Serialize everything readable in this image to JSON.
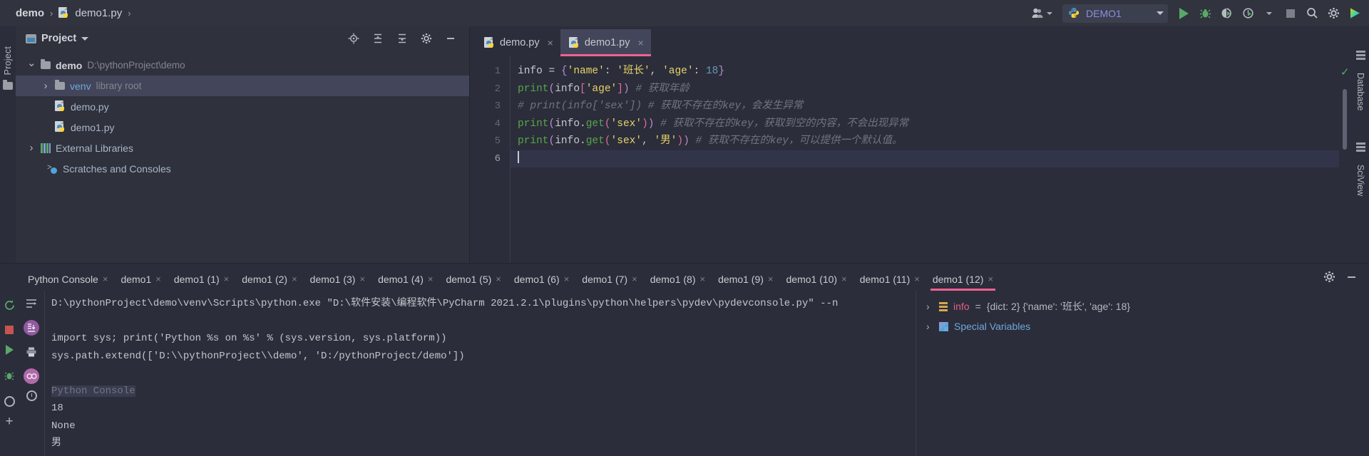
{
  "breadcrumb": {
    "project": "demo",
    "sep": "›",
    "file": "demo1.py",
    "trail": "›"
  },
  "topbar": {
    "account_icon": "user-accounts-icon",
    "run_config": {
      "label": "DEMO1",
      "icon": "python-icon"
    },
    "buttons": [
      {
        "name": "run-button",
        "label": "▶"
      },
      {
        "name": "debug-button",
        "label": "debug-bug-icon"
      },
      {
        "name": "run-coverage-button",
        "label": "coverage-icon"
      },
      {
        "name": "profile-button",
        "label": "profiler-icon"
      },
      {
        "name": "stop-button",
        "label": "stop-icon"
      },
      {
        "name": "search-everywhere-button",
        "label": "search-icon"
      },
      {
        "name": "settings-button",
        "label": "gear-icon"
      },
      {
        "name": "ide-feature-button",
        "label": "gradient-play-icon"
      }
    ]
  },
  "left_strip": {
    "project_label": "Project"
  },
  "project_panel": {
    "title": "Project",
    "toolbar_icons": [
      "locate-icon",
      "expand-all-icon",
      "collapse-all-icon",
      "settings-gear-icon",
      "hide-icon"
    ],
    "tree": [
      {
        "indent": 0,
        "arrow": "down",
        "name": "demo",
        "suffix": "D:\\pythonProject\\demo",
        "icon": "folder-icon",
        "bold": true,
        "selected": false
      },
      {
        "indent": 1,
        "arrow": "right",
        "name": "venv",
        "suffix": "library root",
        "icon": "folder-icon",
        "bold": false,
        "selected": true,
        "link": true
      },
      {
        "indent": 2,
        "arrow": "none",
        "name": "demo.py",
        "suffix": "",
        "icon": "python-file-icon",
        "bold": false,
        "selected": false
      },
      {
        "indent": 2,
        "arrow": "none",
        "name": "demo1.py",
        "suffix": "",
        "icon": "python-file-icon",
        "bold": false,
        "selected": false
      },
      {
        "indent": 0,
        "arrow": "right",
        "name": "External Libraries",
        "suffix": "",
        "icon": "libraries-icon",
        "bold": false,
        "selected": false
      },
      {
        "indent": 0,
        "arrow": "none",
        "name": "Scratches and Consoles",
        "suffix": "",
        "icon": "scratches-icon",
        "bold": false,
        "selected": false
      }
    ]
  },
  "editor": {
    "tabs": [
      {
        "label": "demo.py",
        "active": false,
        "close": "×"
      },
      {
        "label": "demo1.py",
        "active": true,
        "close": "×"
      }
    ],
    "line_numbers": [
      "1",
      "2",
      "3",
      "4",
      "5",
      "6"
    ],
    "current_line": 6,
    "inspection_status": "✓",
    "code": [
      {
        "n": 1,
        "tokens": [
          {
            "t": "info",
            "c": "var"
          },
          {
            "t": " ",
            "c": "op"
          },
          {
            "t": "=",
            "c": "op"
          },
          {
            "t": " ",
            "c": "op"
          },
          {
            "t": "{",
            "c": "brk"
          },
          {
            "t": "'name'",
            "c": "strY"
          },
          {
            "t": ":",
            "c": "op"
          },
          {
            "t": " ",
            "c": "op"
          },
          {
            "t": "'班长'",
            "c": "strY"
          },
          {
            "t": ",",
            "c": "op"
          },
          {
            "t": " ",
            "c": "op"
          },
          {
            "t": "'age'",
            "c": "strY"
          },
          {
            "t": ":",
            "c": "op"
          },
          {
            "t": " ",
            "c": "op"
          },
          {
            "t": "18",
            "c": "num"
          },
          {
            "t": "}",
            "c": "brk"
          }
        ]
      },
      {
        "n": 2,
        "tokens": [
          {
            "t": "print",
            "c": "fn"
          },
          {
            "t": "(",
            "c": "brk"
          },
          {
            "t": "info",
            "c": "var"
          },
          {
            "t": "[",
            "c": "brk2"
          },
          {
            "t": "'age'",
            "c": "strY"
          },
          {
            "t": "]",
            "c": "brk2"
          },
          {
            "t": ")",
            "c": "brk"
          },
          {
            "t": "  # 获取年龄",
            "c": "cmt"
          }
        ]
      },
      {
        "n": 3,
        "tokens": [
          {
            "t": "# print(info['sex']) # 获取不存在的key，会发生异常",
            "c": "cmt"
          }
        ]
      },
      {
        "n": 4,
        "tokens": [
          {
            "t": "print",
            "c": "fn"
          },
          {
            "t": "(",
            "c": "brk"
          },
          {
            "t": "info",
            "c": "var"
          },
          {
            "t": ".",
            "c": "op"
          },
          {
            "t": "get",
            "c": "fn"
          },
          {
            "t": "(",
            "c": "brk2"
          },
          {
            "t": "'sex'",
            "c": "strY"
          },
          {
            "t": ")",
            "c": "brk2"
          },
          {
            "t": ")",
            "c": "brk"
          },
          {
            "t": "  # 获取不存在的key，获取到空的内容，不会出现异常",
            "c": "cmt"
          }
        ]
      },
      {
        "n": 5,
        "tokens": [
          {
            "t": "print",
            "c": "fn"
          },
          {
            "t": "(",
            "c": "brk"
          },
          {
            "t": "info",
            "c": "var"
          },
          {
            "t": ".",
            "c": "op"
          },
          {
            "t": "get",
            "c": "fn"
          },
          {
            "t": "(",
            "c": "brk2"
          },
          {
            "t": "'sex'",
            "c": "strY"
          },
          {
            "t": ",",
            "c": "op"
          },
          {
            "t": " ",
            "c": "op"
          },
          {
            "t": "'男'",
            "c": "strY"
          },
          {
            "t": ")",
            "c": "brk2"
          },
          {
            "t": ")",
            "c": "brk"
          },
          {
            "t": "  # 获取不存在的key，可以提供一个默认值。",
            "c": "cmt"
          }
        ]
      },
      {
        "n": 6,
        "tokens": []
      }
    ]
  },
  "right_strip": {
    "labels": [
      "Database",
      "SciView"
    ]
  },
  "console": {
    "tabs": [
      {
        "label": "Python Console",
        "active": false
      },
      {
        "label": "demo1",
        "active": false
      },
      {
        "label": "demo1 (1)",
        "active": false
      },
      {
        "label": "demo1 (2)",
        "active": false
      },
      {
        "label": "demo1 (3)",
        "active": false
      },
      {
        "label": "demo1 (4)",
        "active": false
      },
      {
        "label": "demo1 (5)",
        "active": false
      },
      {
        "label": "demo1 (6)",
        "active": false
      },
      {
        "label": "demo1 (7)",
        "active": false
      },
      {
        "label": "demo1 (8)",
        "active": false
      },
      {
        "label": "demo1 (9)",
        "active": false
      },
      {
        "label": "demo1 (10)",
        "active": false
      },
      {
        "label": "demo1 (11)",
        "active": false
      },
      {
        "label": "demo1 (12)",
        "active": true
      }
    ],
    "tab_close_glyph": "×",
    "header_buttons": [
      "settings-gear-icon",
      "minimize-icon"
    ],
    "left_buttons": [
      "rerun-icon",
      "stop-icon",
      "run-icon",
      "debug-icon",
      "settings-icon",
      "add-icon"
    ],
    "left_buttons2": [
      "soft-wrap-icon",
      "scroll-to-end-icon",
      "print-icon",
      "show-variables-icon",
      "history-icon"
    ],
    "output": [
      {
        "text": "D:\\pythonProject\\demo\\venv\\Scripts\\python.exe \"D:\\软件安装\\编程软件\\PyCharm 2021.2.1\\plugins\\python\\helpers\\pydev\\pydevconsole.py\" --n",
        "style": "normal"
      },
      {
        "text": "",
        "style": "normal"
      },
      {
        "text": "import sys; print('Python %s on %s' % (sys.version, sys.platform))",
        "style": "normal"
      },
      {
        "text": "sys.path.extend(['D:\\\\pythonProject\\\\demo', 'D:/pythonProject/demo'])",
        "style": "normal"
      },
      {
        "text": "",
        "style": "normal"
      },
      {
        "text": "Python Console",
        "style": "dim-highlight"
      },
      {
        "text": "18",
        "style": "normal"
      },
      {
        "text": "None",
        "style": "normal"
      },
      {
        "text": "男",
        "style": "normal"
      }
    ],
    "variables": [
      {
        "arrow": "›",
        "icon": "dict-list-icon",
        "name": "info",
        "eq": " = ",
        "value": "{dict: 2} {'name': '班长', 'age': 18}"
      },
      {
        "arrow": "›",
        "icon": "special-variables-icon",
        "name": "Special Variables",
        "eq": "",
        "value": ""
      }
    ]
  }
}
